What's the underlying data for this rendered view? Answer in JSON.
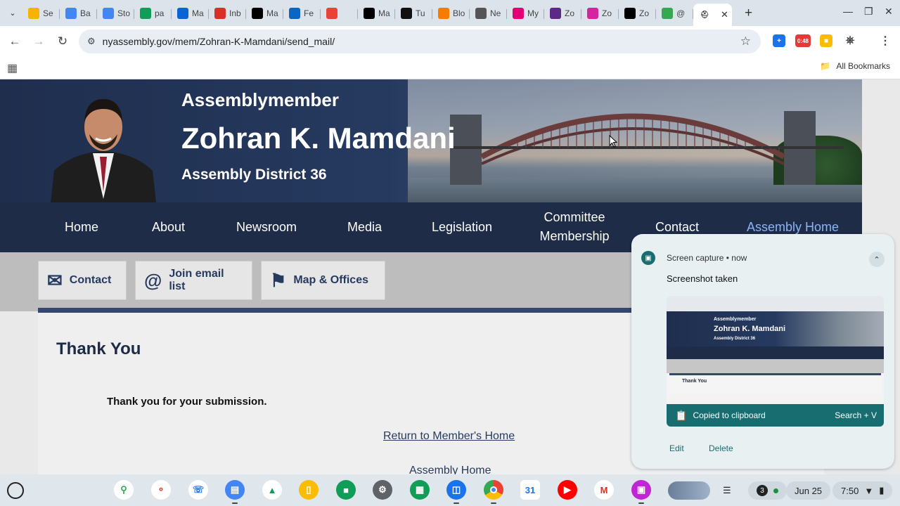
{
  "browser": {
    "tabs": [
      {
        "label": "Se",
        "icon": "google-drive-icon",
        "color": "#f4b400"
      },
      {
        "label": "Ba",
        "icon": "google-docs-icon",
        "color": "#4285f4"
      },
      {
        "label": "Sto",
        "icon": "google-docs-icon",
        "color": "#4285f4"
      },
      {
        "label": "pa",
        "icon": "google-sheets-icon",
        "color": "#0f9d58"
      },
      {
        "label": "Ma",
        "icon": "outlook-icon",
        "color": "#0a64d6"
      },
      {
        "label": "Inb",
        "icon": "gmail-icon",
        "color": "#d93025"
      },
      {
        "label": "Ma",
        "icon": "x-icon",
        "color": "#000000"
      },
      {
        "label": "Fe",
        "icon": "linkedin-icon",
        "color": "#0a66c2"
      },
      {
        "label": "",
        "icon": "google-photos-icon",
        "color": "#ea4335"
      },
      {
        "label": "Ma",
        "icon": "x-icon",
        "color": "#000000"
      },
      {
        "label": "Tu",
        "icon": "threads-icon",
        "color": "#111111"
      },
      {
        "label": "Blo",
        "icon": "blogger-icon",
        "color": "#f57c00"
      },
      {
        "label": "Ne",
        "icon": "globe-icon",
        "color": "#555555"
      },
      {
        "label": "My",
        "icon": "t-mobile-icon",
        "color": "#e20074"
      },
      {
        "label": "Zo",
        "icon": "z-icon",
        "color": "#5b2a86"
      },
      {
        "label": "Zo",
        "icon": "instagram-icon",
        "color": "#d6249f"
      },
      {
        "label": "Zo",
        "icon": "x-icon",
        "color": "#000000"
      },
      {
        "label": "@",
        "icon": "asterisk-icon",
        "color": "#34a853"
      }
    ],
    "url": "nyassembly.gov/mem/Zohran-K-Mamdani/send_mail/",
    "bookmarks_label": "All Bookmarks",
    "ext_timer": "0:48"
  },
  "site": {
    "pre_title": "Assemblymember",
    "name": "Zohran K. Mamdani",
    "district": "Assembly District 36",
    "nav": [
      "Home",
      "About",
      "Newsroom",
      "Media",
      "Legislation",
      "Committee Membership",
      "Contact",
      "Assembly Home"
    ],
    "quicklinks": [
      "Contact",
      "Join email list",
      "Map & Offices"
    ],
    "content": {
      "title": "Thank You",
      "message": "Thank you for your submission.",
      "link_member": "Return to Member's Home",
      "link_assembly": "Assembly Home"
    }
  },
  "notification": {
    "source": "Screen capture",
    "time": "now",
    "title": "Screenshot taken",
    "clipboard": "Copied to clipboard",
    "shortcut": "Search + V",
    "edit": "Edit",
    "delete": "Delete",
    "thumb_name": "Zohran K. Mamdani",
    "thumb_pre": "Assemblymember",
    "thumb_district": "Assembly District 36",
    "thumb_title": "Thank You"
  },
  "shelf": {
    "notification_count": "3",
    "date": "Jun 25",
    "time": "7:50"
  }
}
